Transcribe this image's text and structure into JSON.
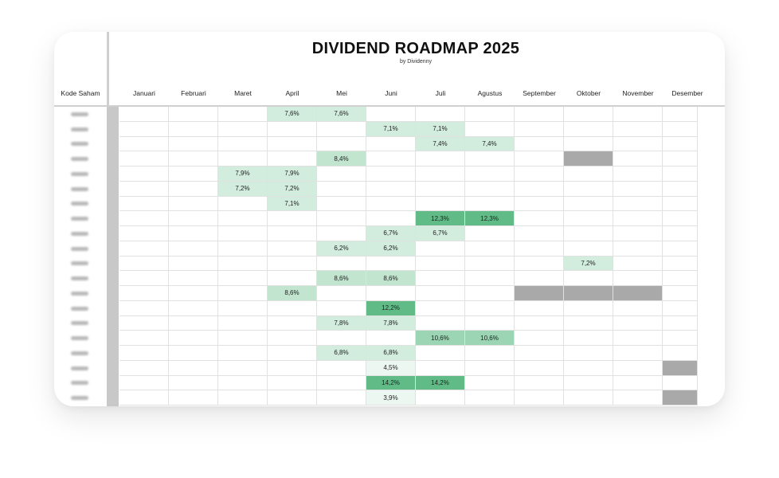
{
  "title": "DIVIDEND ROADMAP 2025",
  "subtitle": "by Dividenny",
  "code_header": "Kode Saham",
  "months": [
    "Januari",
    "Februari",
    "Maret",
    "April",
    "Mei",
    "Juni",
    "Juli",
    "Agustus",
    "September",
    "Oktober",
    "November",
    "Desember"
  ],
  "legend_colors": {
    "yield_low": "#edf7f1",
    "yield_mid": "#d2ecde",
    "yield_midhigh": "#c1e5cf",
    "yield_high": "#9cd5b3",
    "yield_top": "#60bb87",
    "marked_gray": "#a9a9a9"
  },
  "rows": [
    {
      "code": "",
      "cells": [
        {
          "month": 3,
          "text": "7,6%",
          "level": "mid"
        },
        {
          "month": 4,
          "text": "7,6%",
          "level": "mid"
        }
      ]
    },
    {
      "code": "",
      "cells": [
        {
          "month": 5,
          "text": "7,1%",
          "level": "mid"
        },
        {
          "month": 6,
          "text": "7,1%",
          "level": "mid"
        }
      ]
    },
    {
      "code": "",
      "cells": [
        {
          "month": 6,
          "text": "7,4%",
          "level": "mid"
        },
        {
          "month": 7,
          "text": "7,4%",
          "level": "mid"
        }
      ]
    },
    {
      "code": "",
      "cells": [
        {
          "month": 4,
          "text": "8,4%",
          "level": "midhigh"
        },
        {
          "month": 9,
          "text": "",
          "level": "gray"
        }
      ]
    },
    {
      "code": "",
      "cells": [
        {
          "month": 2,
          "text": "7,9%",
          "level": "mid"
        },
        {
          "month": 3,
          "text": "7,9%",
          "level": "mid"
        }
      ]
    },
    {
      "code": "",
      "cells": [
        {
          "month": 2,
          "text": "7,2%",
          "level": "mid"
        },
        {
          "month": 3,
          "text": "7,2%",
          "level": "mid"
        }
      ]
    },
    {
      "code": "",
      "cells": [
        {
          "month": 3,
          "text": "7,1%",
          "level": "mid"
        }
      ]
    },
    {
      "code": "",
      "cells": [
        {
          "month": 6,
          "text": "12,3%",
          "level": "top"
        },
        {
          "month": 7,
          "text": "12,3%",
          "level": "top"
        }
      ]
    },
    {
      "code": "",
      "cells": [
        {
          "month": 5,
          "text": "6,7%",
          "level": "mid"
        },
        {
          "month": 6,
          "text": "6,7%",
          "level": "mid"
        }
      ]
    },
    {
      "code": "",
      "cells": [
        {
          "month": 4,
          "text": "6,2%",
          "level": "mid"
        },
        {
          "month": 5,
          "text": "6,2%",
          "level": "mid"
        }
      ]
    },
    {
      "code": "",
      "cells": [
        {
          "month": 9,
          "text": "7,2%",
          "level": "mid"
        }
      ]
    },
    {
      "code": "",
      "cells": [
        {
          "month": 4,
          "text": "8,6%",
          "level": "midhigh"
        },
        {
          "month": 5,
          "text": "8,6%",
          "level": "midhigh"
        }
      ]
    },
    {
      "code": "",
      "cells": [
        {
          "month": 3,
          "text": "8,6%",
          "level": "midhigh"
        },
        {
          "month": 8,
          "text": "",
          "level": "gray"
        },
        {
          "month": 9,
          "text": "",
          "level": "gray"
        },
        {
          "month": 10,
          "text": "",
          "level": "gray"
        }
      ]
    },
    {
      "code": "",
      "cells": [
        {
          "month": 5,
          "text": "12,2%",
          "level": "top"
        }
      ]
    },
    {
      "code": "",
      "cells": [
        {
          "month": 4,
          "text": "7,8%",
          "level": "mid"
        },
        {
          "month": 5,
          "text": "7,8%",
          "level": "mid"
        }
      ]
    },
    {
      "code": "",
      "cells": [
        {
          "month": 6,
          "text": "10,6%",
          "level": "high"
        },
        {
          "month": 7,
          "text": "10,6%",
          "level": "high"
        }
      ]
    },
    {
      "code": "",
      "cells": [
        {
          "month": 4,
          "text": "6,8%",
          "level": "mid"
        },
        {
          "month": 5,
          "text": "6,8%",
          "level": "mid"
        }
      ]
    },
    {
      "code": "",
      "cells": [
        {
          "month": 5,
          "text": "4,5%",
          "level": "low"
        },
        {
          "month": 11,
          "text": "",
          "level": "gray"
        }
      ]
    },
    {
      "code": "",
      "cells": [
        {
          "month": 5,
          "text": "14,2%",
          "level": "top"
        },
        {
          "month": 6,
          "text": "14,2%",
          "level": "top"
        }
      ]
    },
    {
      "code": "",
      "cells": [
        {
          "month": 5,
          "text": "3,9%",
          "level": "low"
        },
        {
          "month": 11,
          "text": "",
          "level": "gray"
        }
      ]
    }
  ]
}
